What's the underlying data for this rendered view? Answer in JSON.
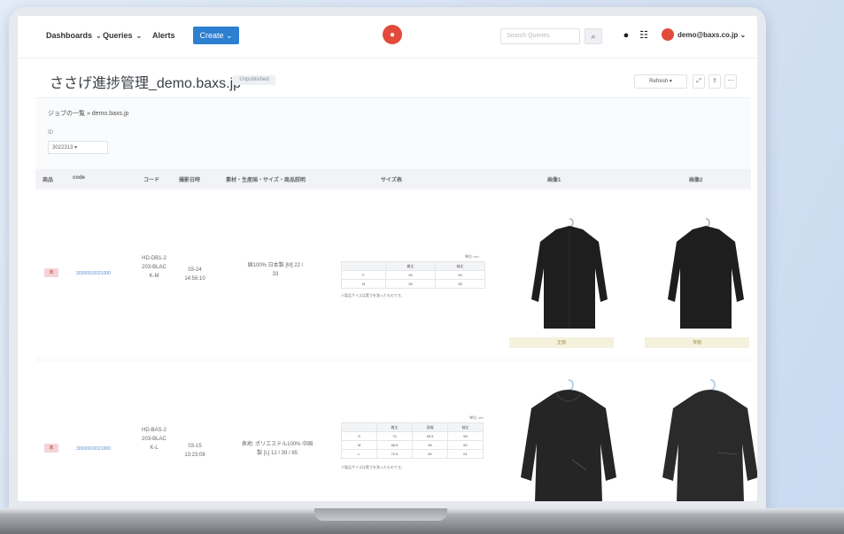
{
  "nav": {
    "dashboards": "Dashboards",
    "queries": "Queries",
    "alerts": "Alerts",
    "create": "Create",
    "search_placeholder": "Search Queries",
    "user": "demo@baxs.co.jp"
  },
  "page": {
    "title": "ささげ進捗管理_demo.baxs.jp",
    "tag": "Unpublished",
    "refresh": "Refresh",
    "breadcrumb": "ジョブの一覧 » demo.baxs.jp",
    "filter_label": "ID",
    "filter_value": "3022313"
  },
  "table": {
    "headers": [
      "商品",
      "code",
      "コード",
      "撮影日時",
      "素材・生産国・サイズ・商品説明",
      "サイズ表",
      "画像1",
      "画像2"
    ]
  },
  "rows": [
    {
      "status": "未",
      "code": "30306910021000",
      "product_code": "HD-DB1-2203-BLACK-M",
      "date": "03-24 14:56:10",
      "desc": "綿100% 日本製 [M] 22 / 33",
      "size_unit": "単位: cm",
      "size_headers": [
        "",
        "着丈",
        "袖丈"
      ],
      "size_rows": [
        [
          "F",
          "35",
          "30"
        ],
        [
          "M",
          "35",
          "35"
        ]
      ],
      "size_note": "※製品サイズは実寸を測ったものです。",
      "img1_caption": "正面",
      "img2_caption": "背面"
    },
    {
      "status": "未",
      "code": "30306910021000",
      "product_code": "HD-BAS-2203-BLACK-L",
      "date": "03-15 13:23:08",
      "desc": "表地: ポリエステル100% 中国製 [L] 12 / 39 / 65",
      "size_unit": "単位: cm",
      "size_headers": [
        "",
        "着丈",
        "身幅",
        "袖丈"
      ],
      "size_rows": [
        [
          "S",
          "70",
          "55.5",
          "59"
        ],
        [
          "M",
          "68.5",
          "58",
          "60"
        ],
        [
          "L",
          "72.5",
          "60",
          "61"
        ]
      ],
      "size_note": "※製品サイズは実寸を測ったものです。"
    }
  ]
}
